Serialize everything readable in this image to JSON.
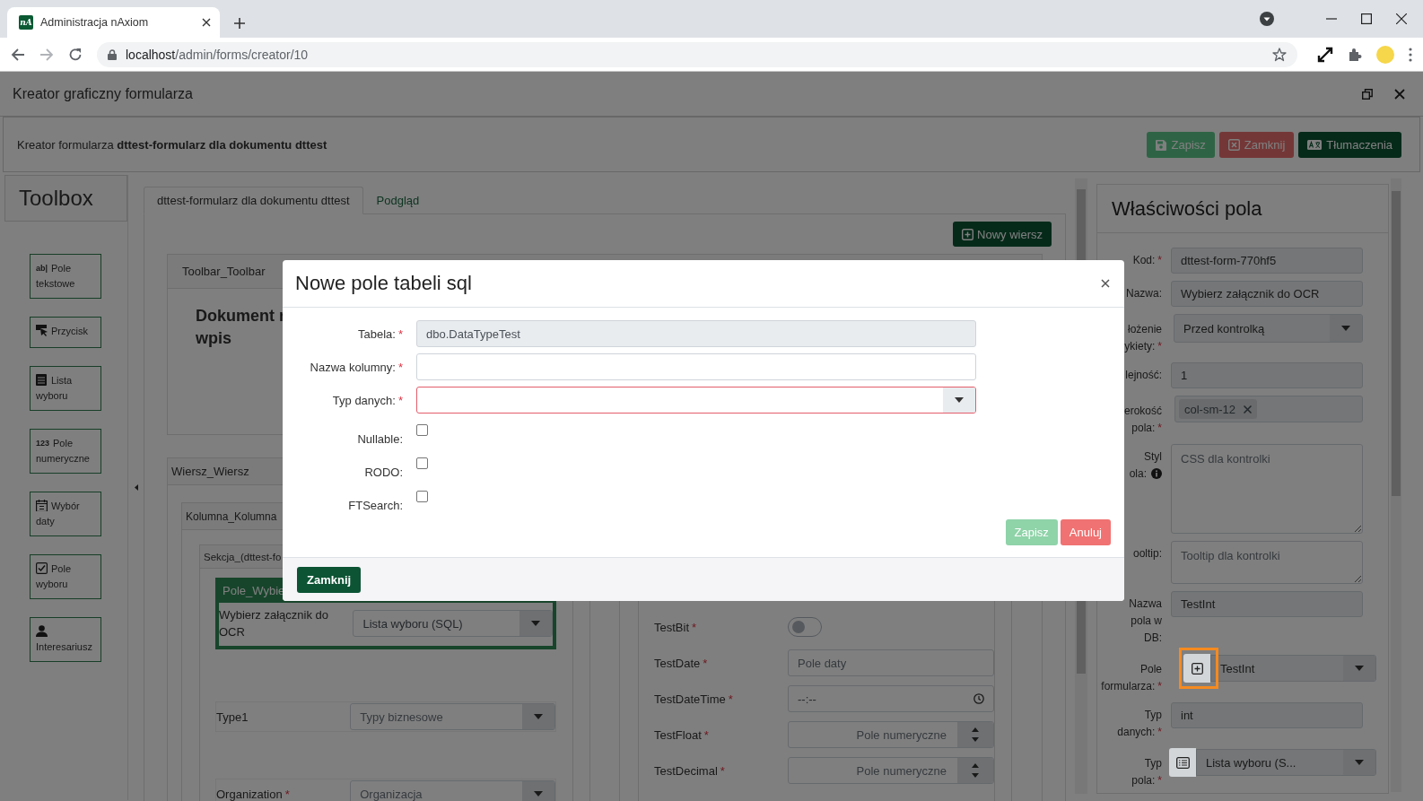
{
  "browser": {
    "favicon_text": "nA",
    "tab_title": "Administracja nAxiom",
    "url_host": "localhost",
    "url_path": "/admin/forms/creator/10"
  },
  "window": {
    "title": "Kreator graficzny formularza"
  },
  "header": {
    "text": "Kreator formularza **dttest-formularz dla dokumentu dttest**",
    "buttons": [
      {
        "label": "Zapisz",
        "kind": "save"
      },
      {
        "label": "Zamknij",
        "kind": "close"
      },
      {
        "label": "Tłumaczenia",
        "kind": "translate"
      }
    ]
  },
  "toolbox": {
    "title": "Toolbox",
    "items": [
      {
        "label": "Pole tekstowe",
        "kind": "text",
        "icon_text": "ab|"
      },
      {
        "label": "Przycisk",
        "kind": "button"
      },
      {
        "label": "Lista wyboru",
        "kind": "list"
      },
      {
        "label": "Pole numeryczne",
        "kind": "number",
        "icon_text": "123"
      },
      {
        "label": "Wybór daty",
        "kind": "date"
      },
      {
        "label": "Pole wyboru",
        "kind": "checkbox"
      },
      {
        "label": "Interesariusz",
        "kind": "person"
      }
    ]
  },
  "editor": {
    "tabs": [
      {
        "label": "dttest-formularz dla dokumentu dttest",
        "selected": true
      },
      {
        "label": "Podgląd",
        "selected": false
      }
    ],
    "new_row_button": "Nowy wiersz",
    "toolbar_card": {
      "title": "Toolbar_Toolbar",
      "heading": [
        "Dokument r",
        "wpis"
      ]
    },
    "row_card": {
      "title": "Wiersz_Wiersz"
    },
    "column_card": {
      "title": "Kolumna_Kolumna"
    },
    "section_card": {
      "title": "Sekcja_(dttest-fo"
    },
    "selected_field": {
      "title": "Pole_Wybie",
      "label": "Wybierz załącznik do OCR",
      "value": "Lista wyboru (SQL)",
      "selected": true
    },
    "left_fields": [
      {
        "kind": "select",
        "label": "Type1",
        "placeholder": "Typy biznesowe"
      },
      {
        "kind": "select",
        "label": "Organization",
        "required_mark": "*",
        "placeholder": "Organizacja"
      }
    ],
    "right_fields": [
      {
        "kind": "toggle",
        "label": "TestBit",
        "required_mark": "*",
        "on": false
      },
      {
        "kind": "text",
        "label": "TestDate",
        "required_mark": "*",
        "placeholder": "Pole daty"
      },
      {
        "kind": "time",
        "label": "TestDateTime",
        "required_mark": "*",
        "placeholder": "--:--"
      },
      {
        "kind": "number",
        "label": "TestFloat",
        "required_mark": "*",
        "placeholder": "Pole numeryczne"
      },
      {
        "kind": "number",
        "label": "TestDecimal",
        "required_mark": "*",
        "placeholder": "Pole numeryczne"
      }
    ]
  },
  "properties": {
    "title": "Właściwości pola",
    "fields": [
      {
        "kind": "text",
        "label": "Kod:",
        "required_mark": "*",
        "value": "dttest-form-770hf5"
      },
      {
        "kind": "text",
        "label": "Nazwa:",
        "value": "Wybierz załącznik do OCR"
      },
      {
        "kind": "select",
        "label": "łożenie\nykiety:",
        "required_mark": "*",
        "value": "Przed kontrolką"
      },
      {
        "kind": "text",
        "label": "lejność:",
        "value": "1"
      },
      {
        "kind": "tags",
        "label": "erokość\npola:",
        "required_mark": "*",
        "tags": [
          "col-sm-12"
        ]
      },
      {
        "kind": "textarea",
        "label": "Styl\nola:",
        "info": true,
        "placeholder": "CSS dla kontrolki"
      },
      {
        "kind": "textarea",
        "label": "ooltip:",
        "placeholder": "Tooltip dla kontrolki"
      },
      {
        "kind": "text",
        "label": "Nazwa\npola w\nDB:",
        "value": "TestInt"
      },
      {
        "kind": "plus_select",
        "label": "Pole\nformularza:",
        "required_mark": "*",
        "highlighted": true,
        "value": "TestInt"
      },
      {
        "kind": "text",
        "label": "Typ\ndanych:",
        "required_mark": "*",
        "value": "int"
      },
      {
        "kind": "list_select",
        "label": "Typ\npola:",
        "required_mark": "*",
        "highlighted": false,
        "value": "Lista wyboru (S..."
      }
    ]
  },
  "modal": {
    "title": "Nowe pole tabeli sql",
    "fields": [
      {
        "kind": "text",
        "label": "Tabela:",
        "required_mark": "*",
        "value": "dbo.DataTypeTest",
        "disabled": true
      },
      {
        "kind": "text",
        "label": "Nazwa kolumny:",
        "required_mark": "*",
        "disabled": false
      },
      {
        "kind": "select",
        "label": "Typ danych:",
        "required_mark": "*",
        "invalid": true
      },
      {
        "kind": "checkbox",
        "label": "Nullable:",
        "checked": false
      },
      {
        "kind": "checkbox",
        "label": "RODO:",
        "checked": false
      },
      {
        "kind": "checkbox",
        "label": "FTSearch:",
        "checked": false
      }
    ],
    "buttons": [
      {
        "label": "Zapisz",
        "kind": "save",
        "disabled": true
      },
      {
        "label": "Anuluj",
        "kind": "cancel",
        "disabled": false
      }
    ],
    "footer_button": "Zamknij"
  }
}
